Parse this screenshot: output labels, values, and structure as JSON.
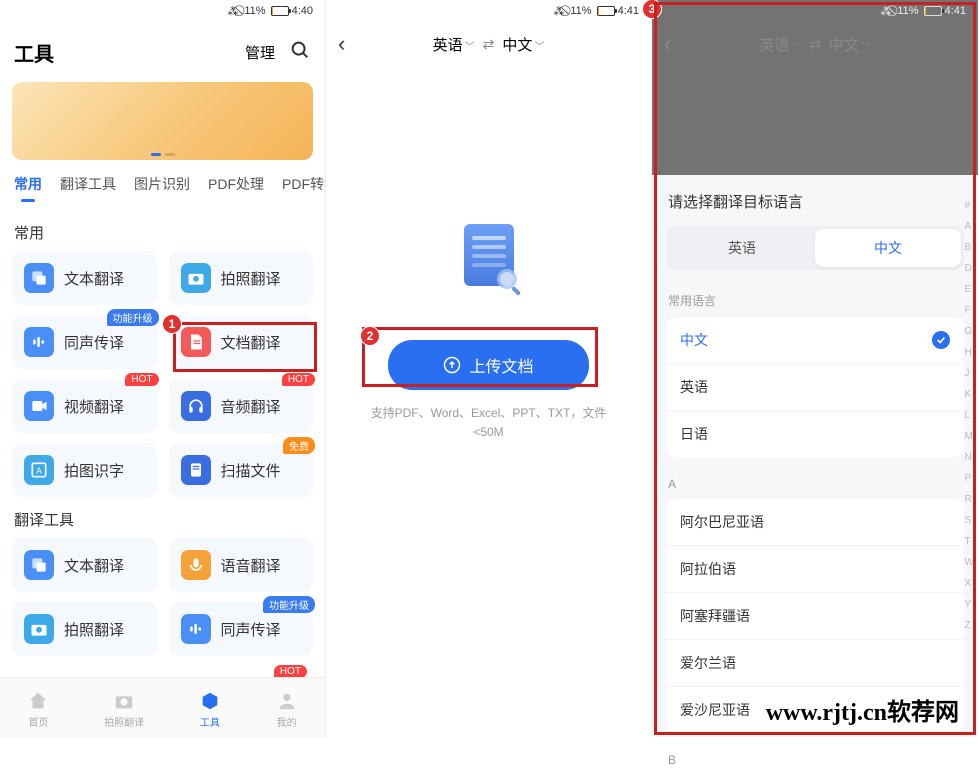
{
  "status": {
    "bt_mute": "⁂⃠",
    "battery_pct": "11%",
    "time_s1": "4:40",
    "time_s2": "4:41",
    "time_s3": "4:41"
  },
  "screen1": {
    "title": "工具",
    "manage": "管理",
    "tabs": [
      "常用",
      "翻译工具",
      "图片识别",
      "PDF处理",
      "PDF转换",
      "转"
    ],
    "section_common": "常用",
    "section_translate": "翻译工具",
    "tools_common": [
      {
        "label": "文本翻译"
      },
      {
        "label": "拍照翻译"
      },
      {
        "label": "同声传译",
        "badge": "功能升级",
        "badge_cls": "badge-blue"
      },
      {
        "label": "文档翻译"
      },
      {
        "label": "视频翻译",
        "badge": "HOT",
        "badge_cls": "badge-red"
      },
      {
        "label": "音频翻译",
        "badge": "HOT",
        "badge_cls": "badge-red"
      },
      {
        "label": "拍图识字"
      },
      {
        "label": "扫描文件",
        "badge": "免费",
        "badge_cls": "badge-orange"
      }
    ],
    "tools_translate": [
      {
        "label": "文本翻译"
      },
      {
        "label": "语音翻译"
      },
      {
        "label": "拍照翻译"
      },
      {
        "label": "同声传译",
        "badge": "功能升级",
        "badge_cls": "badge-blue"
      }
    ],
    "nav": [
      {
        "label": "首页"
      },
      {
        "label": "拍照翻译"
      },
      {
        "label": "工具"
      },
      {
        "label": "我的"
      }
    ],
    "hot_cut": "HOT"
  },
  "screen2": {
    "lang_from": "英语",
    "lang_to": "中文",
    "upload_label": "上传文档",
    "hint": "支持PDF、Word、Excel、PPT、TXT，文件<50M"
  },
  "screen3": {
    "lang_from": "英语",
    "lang_to": "中文",
    "sheet_title": "请选择翻译目标语言",
    "seg": [
      "英语",
      "中文"
    ],
    "group_common_label": "常用语言",
    "common_langs": [
      "中文",
      "英语",
      "日语"
    ],
    "group_a_label": "A",
    "a_langs": [
      "阿尔巴尼亚语",
      "阿拉伯语",
      "阿塞拜疆语",
      "爱尔兰语",
      "爱沙尼亚语"
    ],
    "group_b_label": "B",
    "alpha": [
      "#",
      "A",
      "B",
      "D",
      "E",
      "F",
      "G",
      "H",
      "J",
      "K",
      "L",
      "M",
      "N",
      "P",
      "R",
      "S",
      "T",
      "W",
      "X",
      "Y",
      "Z"
    ]
  },
  "markers": {
    "m1": "1",
    "m2": "2",
    "m3": "3"
  },
  "watermark": "www.rjtj.cn软荐网"
}
